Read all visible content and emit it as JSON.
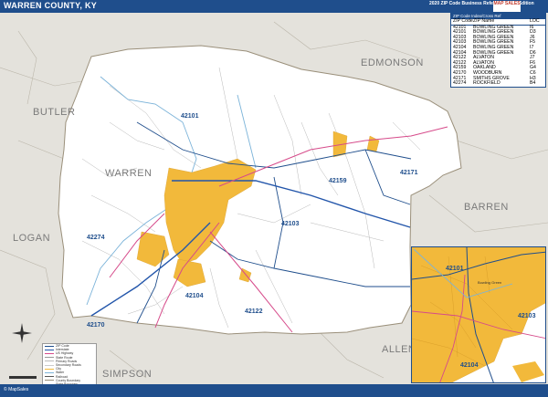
{
  "header": {
    "title": "WARREN COUNTY, KY",
    "edition": "2020 ZIP Code Business Reference Inset Edition",
    "logo_text": "MAP SALES"
  },
  "footer": {
    "copyright": "© MapSales"
  },
  "counties": {
    "main": "WARREN",
    "butler": "BUTLER",
    "edmonson": "EDMONSON",
    "barren": "BARREN",
    "logan": "LOGAN",
    "simpson": "SIMPSON",
    "allen": "ALLEN"
  },
  "zip_labels": {
    "z42101": "42101",
    "z42159": "42159",
    "z42171": "42171",
    "z42103": "42103",
    "z42274": "42274",
    "z42104": "42104",
    "z42122": "42122",
    "z42170": "42170",
    "inset_42101": "42101",
    "inset_42103": "42103",
    "inset_42104": "42104",
    "inset_city": "Bowling Green"
  },
  "zip_table": {
    "title": "ZIP Code Index/Cross Ref",
    "headers": [
      "ZIP Code",
      "ZIP Name",
      "LOC"
    ],
    "rows": [
      [
        "42101",
        "BOWLING GREEN",
        "I6"
      ],
      [
        "42101",
        "BOWLING GREEN",
        "D3"
      ],
      [
        "42103",
        "BOWLING GREEN",
        "J6"
      ],
      [
        "42103",
        "BOWLING GREEN",
        "F5"
      ],
      [
        "42104",
        "BOWLING GREEN",
        "I7"
      ],
      [
        "42104",
        "BOWLING GREEN",
        "D6"
      ],
      [
        "42122",
        "ALVATON",
        "J7"
      ],
      [
        "42122",
        "ALVATON",
        "F6"
      ],
      [
        "42159",
        "OAKLAND",
        "G4"
      ],
      [
        "42170",
        "WOODBURN",
        "C6"
      ],
      [
        "42171",
        "SMITHS GROVE",
        "H3"
      ],
      [
        "42274",
        "ROCKFIELD",
        "B4"
      ]
    ]
  },
  "legend": {
    "rows": [
      "ZIP Code",
      "Interstate",
      "US Highway",
      "State Route",
      "Primary Roads",
      "Secondary Roads",
      "City",
      "Water",
      "Railroad",
      "County Boundary",
      "State Boundary",
      "Large Water"
    ],
    "city_sample": "City"
  },
  "colors": {
    "header_bg": "#1f4e8c",
    "city_fill": "#f2b93b",
    "county_fill": "#ffffff",
    "surround_fill": "#e4e2dc",
    "zip_boundary": "#1f4e8c",
    "interstate": "#2255aa",
    "us_highway": "#d64a8a",
    "water": "#7bb3d9"
  }
}
